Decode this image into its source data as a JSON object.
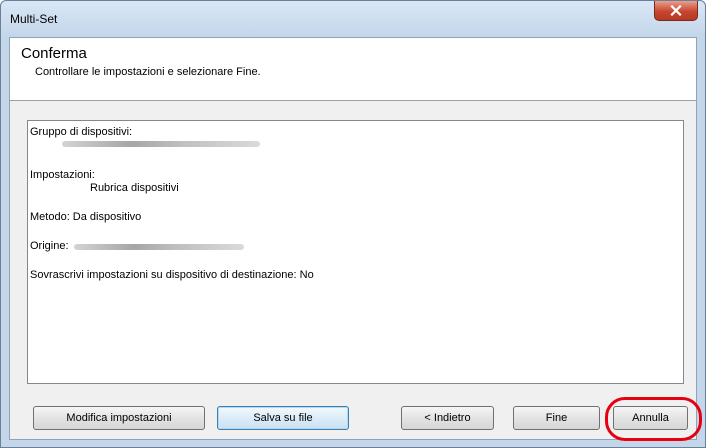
{
  "window": {
    "title": "Multi-Set"
  },
  "header": {
    "title": "Conferma",
    "subtitle": "Controllare le impostazioni e selezionare Fine."
  },
  "summary": {
    "device_group_label": "Gruppo di dispositivi:",
    "settings_label": "Impostazioni:",
    "settings_value": "Rubrica dispositivi",
    "method_line": "Metodo: Da dispositivo",
    "origin_label": "Origine:",
    "overwrite_line": "Sovrascrivi impostazioni su dispositivo di destinazione: No"
  },
  "buttons": {
    "modify": "Modifica impostazioni",
    "save_to_file": "Salva su file",
    "back": "< Indietro",
    "finish": "Fine",
    "cancel": "Annulla"
  },
  "colors": {
    "highlight_ring": "#e60012",
    "title_bar": "#c4d7ea",
    "close_button": "#c8462f"
  }
}
